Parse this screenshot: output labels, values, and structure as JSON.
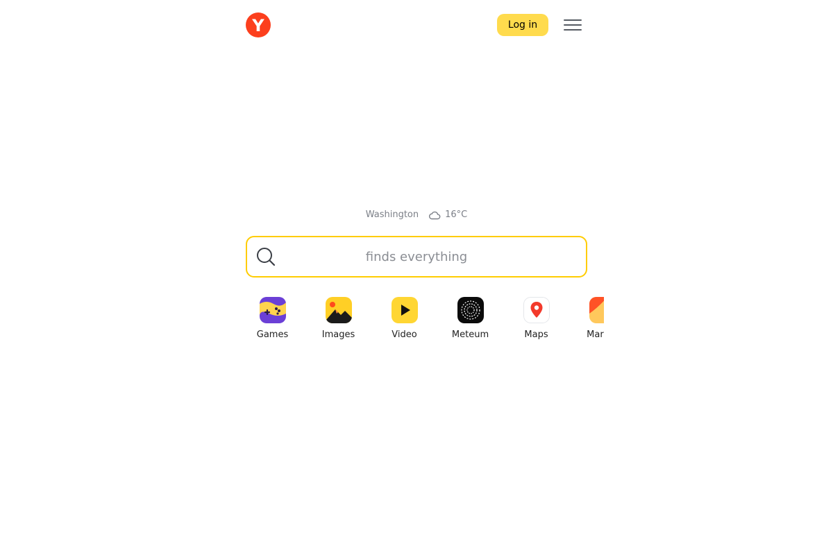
{
  "header": {
    "logo_letter": "Y",
    "login_label": "Log in"
  },
  "weather": {
    "city": "Washington",
    "icon": "cloud-icon",
    "temperature": "16°C"
  },
  "search": {
    "placeholder": "finds everything",
    "value": ""
  },
  "services": [
    {
      "label": "Games",
      "icon": "games-icon"
    },
    {
      "label": "Images",
      "icon": "images-icon"
    },
    {
      "label": "Video",
      "icon": "video-icon"
    },
    {
      "label": "Meteum",
      "icon": "meteum-icon"
    },
    {
      "label": "Maps",
      "icon": "maps-icon"
    },
    {
      "label": "Market",
      "icon": "market-icon"
    }
  ],
  "colors": {
    "brand_red": "#fc3f1d",
    "accent_yellow": "#ffdb4d",
    "search_border": "#ffcc00",
    "muted_text": "#7b7f87"
  }
}
